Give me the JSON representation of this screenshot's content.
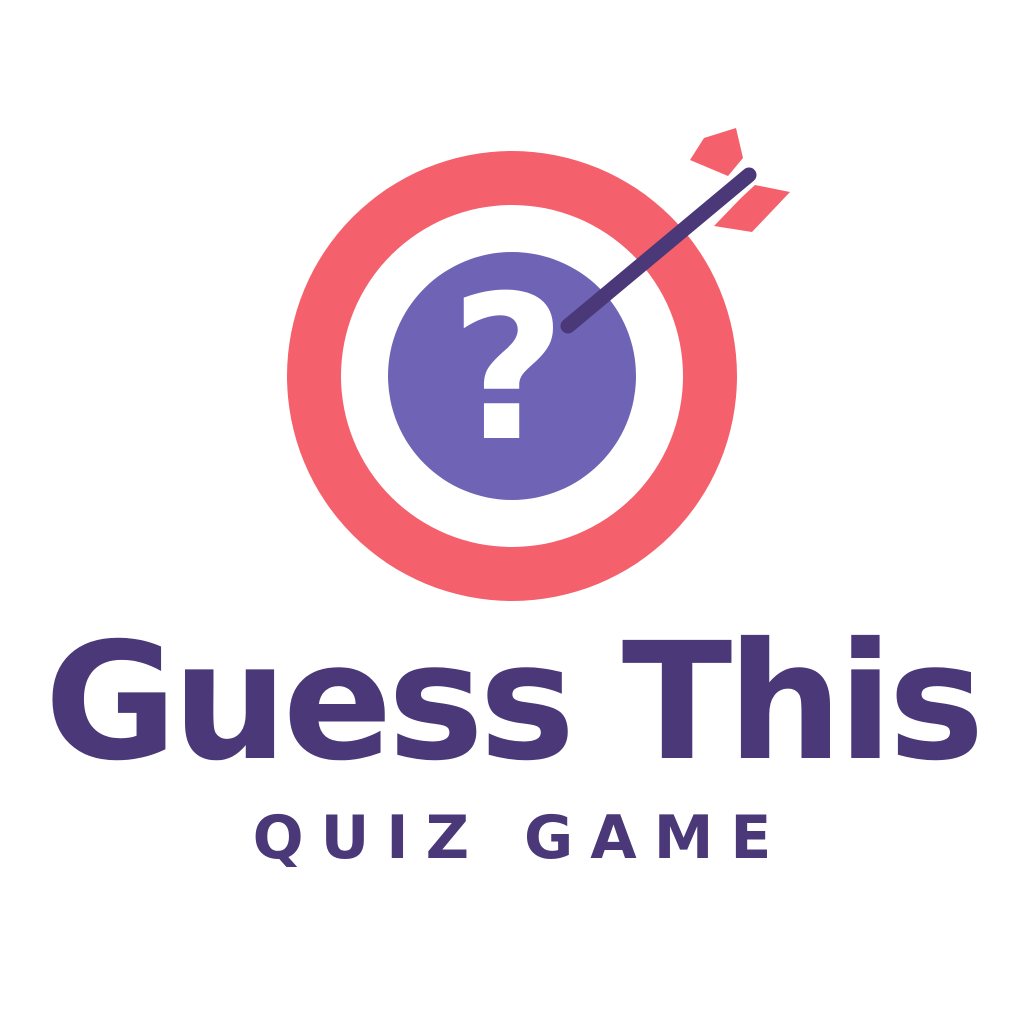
{
  "brand": {
    "name": "Guess This",
    "tagline": "QUIZ GAME"
  },
  "logo": {
    "icon": "target-with-arrow-question-icon",
    "glyph": "?"
  },
  "colors": {
    "coral": "#F4606C",
    "purple": "#6F63B6",
    "dark_purple": "#4A3878",
    "background": "#FFFFFF",
    "white": "#FFFFFF"
  }
}
